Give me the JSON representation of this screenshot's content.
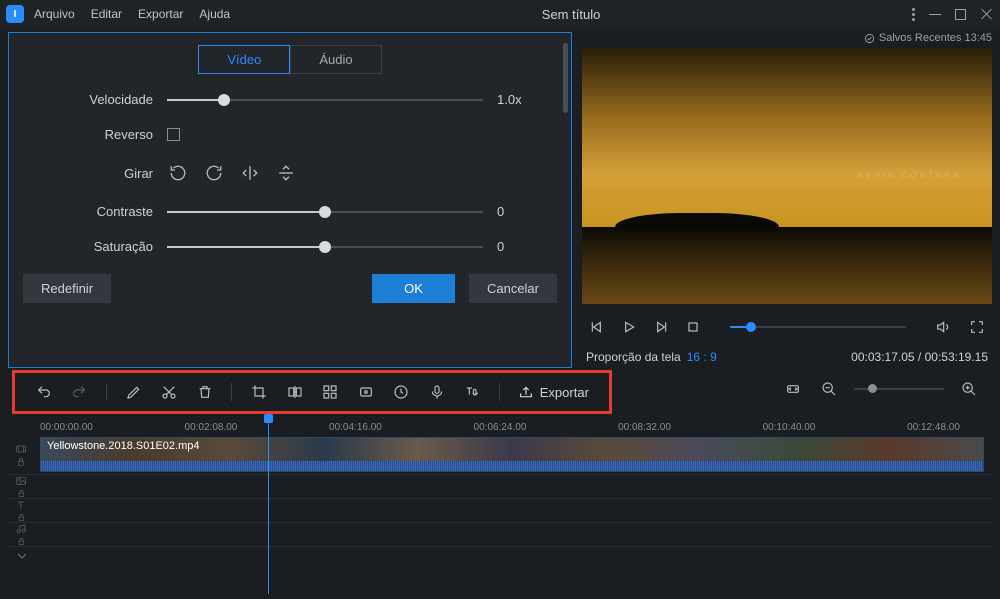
{
  "menu": {
    "file": "Arquivo",
    "edit": "Editar",
    "export": "Exportar",
    "help": "Ajuda"
  },
  "window_title": "Sem título",
  "save_status": "Salvos Recentes 13:45",
  "panel": {
    "tab_video": "Vídeo",
    "tab_audio": "Áudio",
    "speed_label": "Velocidade",
    "speed_value": "1.0x",
    "reverse_label": "Reverso",
    "rotate_label": "Girar",
    "contrast_label": "Contraste",
    "contrast_value": "0",
    "saturation_label": "Saturação",
    "saturation_value": "0",
    "reset": "Redefinir",
    "ok": "OK",
    "cancel": "Cancelar"
  },
  "preview": {
    "credit": "KEVIN COSTNER"
  },
  "ratio": {
    "label": "Proporção da tela",
    "value": "16 : 9"
  },
  "time": {
    "current": "00:03:17.05",
    "total": "00:53:19.15"
  },
  "toolbar": {
    "export": "Exportar"
  },
  "ruler": [
    "00:00:00.00",
    "00:02:08.00",
    "00:04:16.00",
    "00:06:24.00",
    "00:08:32.00",
    "00:10:40.00",
    "00:12:48.00"
  ],
  "clip_name": "Yellowstone.2018.S01E02.mp4"
}
